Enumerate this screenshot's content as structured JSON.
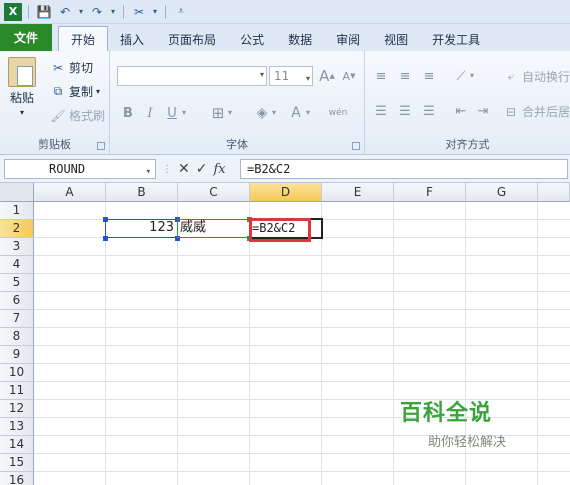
{
  "ribbon_tabs": [
    "文件",
    "开始",
    "插入",
    "页面布局",
    "公式",
    "数据",
    "审阅",
    "视图",
    "开发工具"
  ],
  "active_tab_index": 1,
  "clipboard": {
    "paste": "粘贴",
    "cut": "剪切",
    "copy": "复制",
    "format_painter": "格式刷",
    "group_label": "剪贴板"
  },
  "font": {
    "font_size": "11",
    "group_label": "字体",
    "grow_font": "A",
    "shrink_font": "A",
    "bold": "B",
    "italic": "I",
    "underline": "U",
    "font_color": "A",
    "phonetic": "wén"
  },
  "alignment": {
    "wrap_text": "自动换行",
    "merge_center": "合并后居",
    "group_label": "对齐方式"
  },
  "formula_bar": {
    "name_box": "ROUND",
    "fx": "fx",
    "formula": "=B2&C2"
  },
  "columns": [
    "A",
    "B",
    "C",
    "D",
    "E",
    "F",
    "G"
  ],
  "active_column": "D",
  "rows": [
    "1",
    "2",
    "3",
    "4",
    "5",
    "6",
    "7",
    "8",
    "9",
    "10",
    "11",
    "12",
    "13",
    "14",
    "15",
    "16"
  ],
  "active_row": "2",
  "cells": {
    "B2": "123",
    "C2": "威威",
    "D2": "=B2&C2"
  },
  "watermark": {
    "title": "百科全说",
    "subtitle": "助你轻松解决"
  },
  "colors": {
    "file_tab": "#2a8a2a",
    "ref_blue": "#2c4fd6",
    "ref_green": "#2a9a38",
    "highlight_red": "#e0353a",
    "watermark_green": "#3aa43a"
  }
}
